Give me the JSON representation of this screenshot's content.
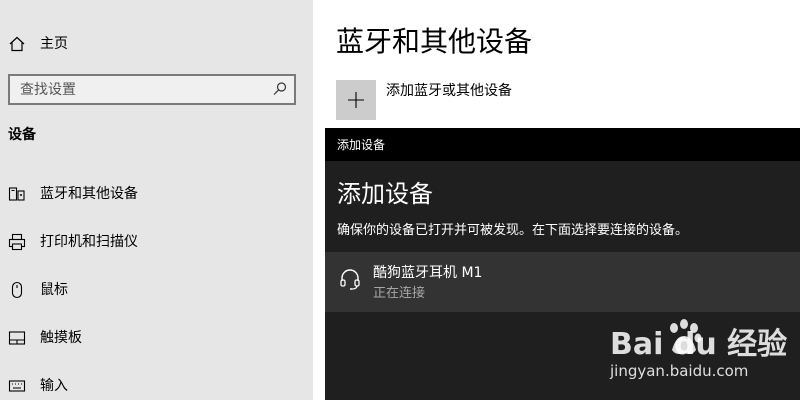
{
  "sidebar": {
    "home_label": "主页",
    "search_placeholder": "查找设置",
    "section_title": "设备",
    "items": [
      {
        "label": "蓝牙和其他设备",
        "icon": "bluetooth-devices-icon"
      },
      {
        "label": "打印机和扫描仪",
        "icon": "printer-icon"
      },
      {
        "label": "鼠标",
        "icon": "mouse-icon"
      },
      {
        "label": "触摸板",
        "icon": "touchpad-icon"
      },
      {
        "label": "输入",
        "icon": "keyboard-icon"
      }
    ]
  },
  "main": {
    "title": "蓝牙和其他设备",
    "add_device_label": "添加蓝牙或其他设备"
  },
  "dialog": {
    "window_title": "添加设备",
    "heading": "添加设备",
    "description": "确保你的设备已打开并可被发现。在下面选择要连接的设备。",
    "devices": [
      {
        "name": "酷狗蓝牙耳机 M1",
        "status": "正在连接",
        "icon": "headset-icon"
      }
    ]
  },
  "watermark": {
    "brand": "Bai du 经验",
    "url": "jingyan.baidu.com"
  },
  "colors": {
    "sidebar_bg": "#e6e6e6",
    "dialog_bg": "#1f1f1f",
    "dialog_titlebar_bg": "#000000",
    "device_row_bg": "#333333",
    "add_tile_bg": "#cccccc"
  }
}
